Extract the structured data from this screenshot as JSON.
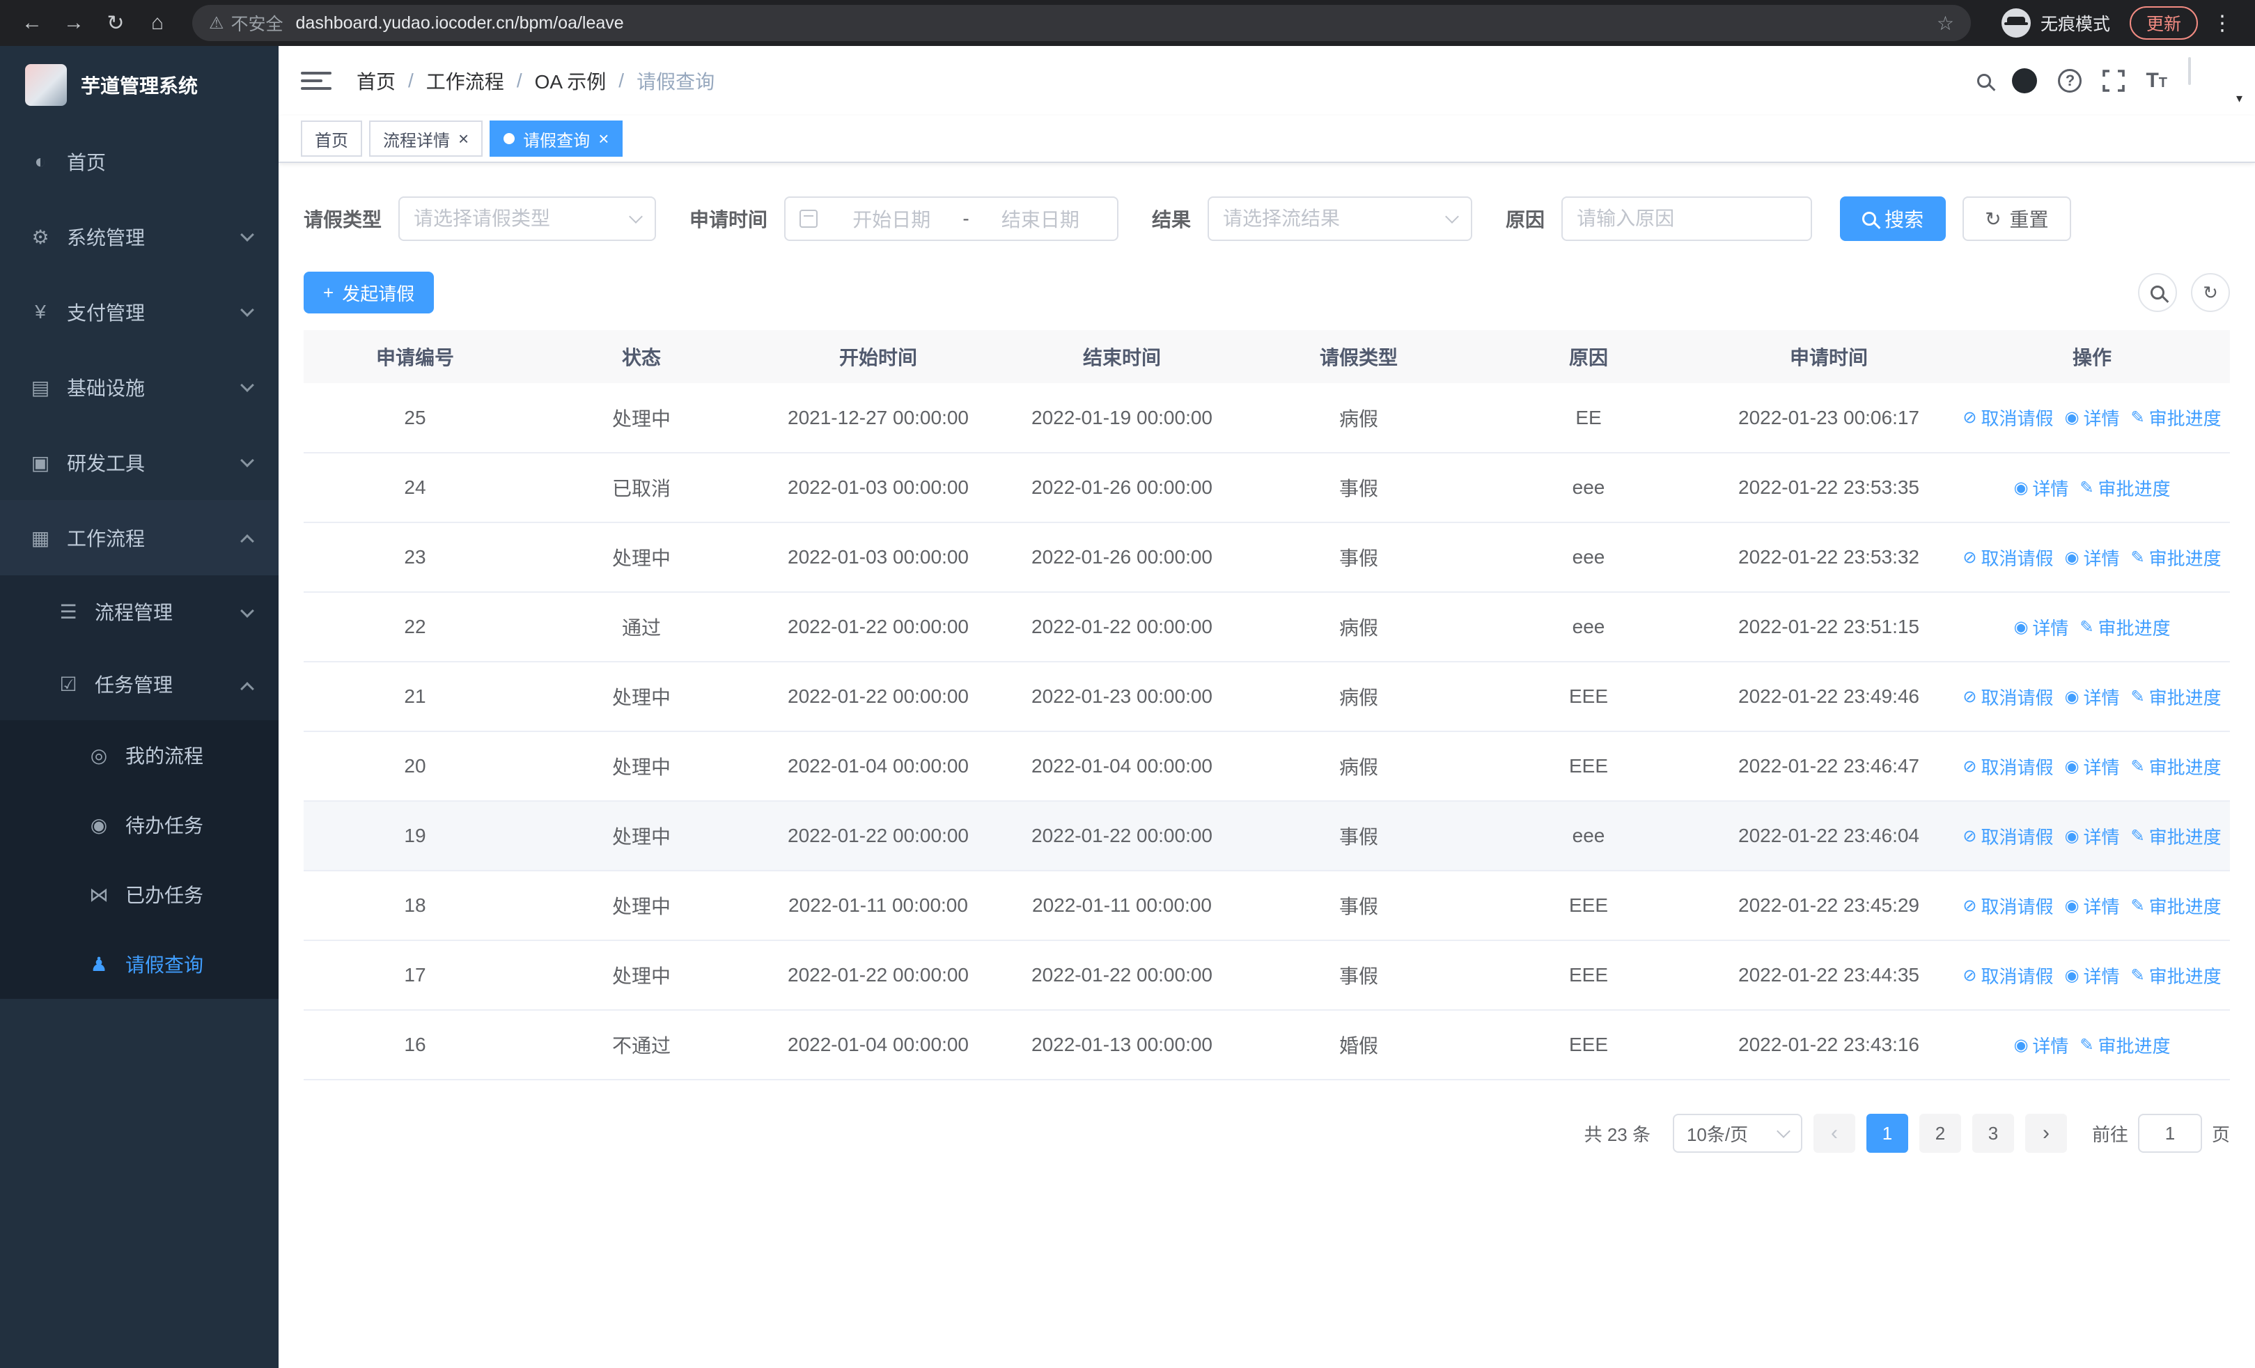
{
  "browser": {
    "security_label": "不安全",
    "url": "dashboard.yudao.iocoder.cn/bpm/oa/leave",
    "incognito_label": "无痕模式",
    "update_label": "更新"
  },
  "sidebar": {
    "app_title": "芋道管理系统",
    "items": [
      {
        "name": "home",
        "label": "首页",
        "icon": "dashboard-icon",
        "level": 1
      },
      {
        "name": "system-management",
        "label": "系统管理",
        "icon": "gear-icon",
        "level": 1,
        "arrow": "down"
      },
      {
        "name": "payment-management",
        "label": "支付管理",
        "icon": "payment-icon",
        "level": 1,
        "arrow": "down"
      },
      {
        "name": "infrastructure",
        "label": "基础设施",
        "icon": "monitor-icon",
        "level": 1,
        "arrow": "down"
      },
      {
        "name": "dev-tools",
        "label": "研发工具",
        "icon": "tools-icon",
        "level": 1,
        "arrow": "down"
      },
      {
        "name": "workflow",
        "label": "工作流程",
        "icon": "workflow-icon",
        "level": 1,
        "arrow": "up",
        "highlight": true
      },
      {
        "name": "process-management",
        "label": "流程管理",
        "icon": "list-icon",
        "level": 2,
        "arrow": "down"
      },
      {
        "name": "task-management",
        "label": "任务管理",
        "icon": "task-icon",
        "level": 2,
        "arrow": "up"
      },
      {
        "name": "my-process",
        "label": "我的流程",
        "icon": "chat-icon",
        "level": 3
      },
      {
        "name": "todo-tasks",
        "label": "待办任务",
        "icon": "eye-icon",
        "level": 3
      },
      {
        "name": "done-tasks",
        "label": "已办任务",
        "icon": "done-icon",
        "level": 3
      },
      {
        "name": "leave-query",
        "label": "请假查询",
        "icon": "user-icon",
        "level": 3,
        "active": true
      }
    ]
  },
  "navbar": {
    "breadcrumb": [
      "首页",
      "工作流程",
      "OA 示例",
      "请假查询"
    ]
  },
  "tabs": [
    {
      "label": "首页",
      "closable": false,
      "active": false
    },
    {
      "label": "流程详情",
      "closable": true,
      "active": false
    },
    {
      "label": "请假查询",
      "closable": true,
      "active": true
    }
  ],
  "filters": {
    "leave_type_label": "请假类型",
    "leave_type_placeholder": "请选择请假类型",
    "apply_time_label": "申请时间",
    "start_date_placeholder": "开始日期",
    "range_separator": "-",
    "end_date_placeholder": "结束日期",
    "result_label": "结果",
    "result_placeholder": "请选择流结果",
    "reason_label": "原因",
    "reason_placeholder": "请输入原因",
    "search_label": "搜索",
    "reset_label": "重置"
  },
  "toolbar": {
    "create_label": "发起请假"
  },
  "table": {
    "columns": [
      "申请编号",
      "状态",
      "开始时间",
      "结束时间",
      "请假类型",
      "原因",
      "申请时间",
      "操作"
    ],
    "op_cancel": "取消请假",
    "op_detail": "详情",
    "op_progress": "审批进度",
    "rows": [
      {
        "id": "25",
        "status": "处理中",
        "start": "2021-12-27 00:00:00",
        "end": "2022-01-19 00:00:00",
        "type": "病假",
        "reason": "EE",
        "apply_time": "2022-01-23 00:06:17",
        "cancellable": true
      },
      {
        "id": "24",
        "status": "已取消",
        "start": "2022-01-03 00:00:00",
        "end": "2022-01-26 00:00:00",
        "type": "事假",
        "reason": "eee",
        "apply_time": "2022-01-22 23:53:35",
        "cancellable": false
      },
      {
        "id": "23",
        "status": "处理中",
        "start": "2022-01-03 00:00:00",
        "end": "2022-01-26 00:00:00",
        "type": "事假",
        "reason": "eee",
        "apply_time": "2022-01-22 23:53:32",
        "cancellable": true
      },
      {
        "id": "22",
        "status": "通过",
        "start": "2022-01-22 00:00:00",
        "end": "2022-01-22 00:00:00",
        "type": "病假",
        "reason": "eee",
        "apply_time": "2022-01-22 23:51:15",
        "cancellable": false
      },
      {
        "id": "21",
        "status": "处理中",
        "start": "2022-01-22 00:00:00",
        "end": "2022-01-23 00:00:00",
        "type": "病假",
        "reason": "EEE",
        "apply_time": "2022-01-22 23:49:46",
        "cancellable": true
      },
      {
        "id": "20",
        "status": "处理中",
        "start": "2022-01-04 00:00:00",
        "end": "2022-01-04 00:00:00",
        "type": "病假",
        "reason": "EEE",
        "apply_time": "2022-01-22 23:46:47",
        "cancellable": true
      },
      {
        "id": "19",
        "status": "处理中",
        "start": "2022-01-22 00:00:00",
        "end": "2022-01-22 00:00:00",
        "type": "事假",
        "reason": "eee",
        "apply_time": "2022-01-22 23:46:04",
        "cancellable": true,
        "highlight": true
      },
      {
        "id": "18",
        "status": "处理中",
        "start": "2022-01-11 00:00:00",
        "end": "2022-01-11 00:00:00",
        "type": "事假",
        "reason": "EEE",
        "apply_time": "2022-01-22 23:45:29",
        "cancellable": true
      },
      {
        "id": "17",
        "status": "处理中",
        "start": "2022-01-22 00:00:00",
        "end": "2022-01-22 00:00:00",
        "type": "事假",
        "reason": "EEE",
        "apply_time": "2022-01-22 23:44:35",
        "cancellable": true
      },
      {
        "id": "16",
        "status": "不通过",
        "start": "2022-01-04 00:00:00",
        "end": "2022-01-13 00:00:00",
        "type": "婚假",
        "reason": "EEE",
        "apply_time": "2022-01-22 23:43:16",
        "cancellable": false
      }
    ]
  },
  "pagination": {
    "total_text": "共 23 条",
    "page_size": "10条/页",
    "pages": [
      "1",
      "2",
      "3"
    ],
    "current": "1",
    "prev_icon": "‹",
    "next_icon": "›",
    "goto_label": "前往",
    "goto_value": "1",
    "goto_suffix": "页"
  }
}
